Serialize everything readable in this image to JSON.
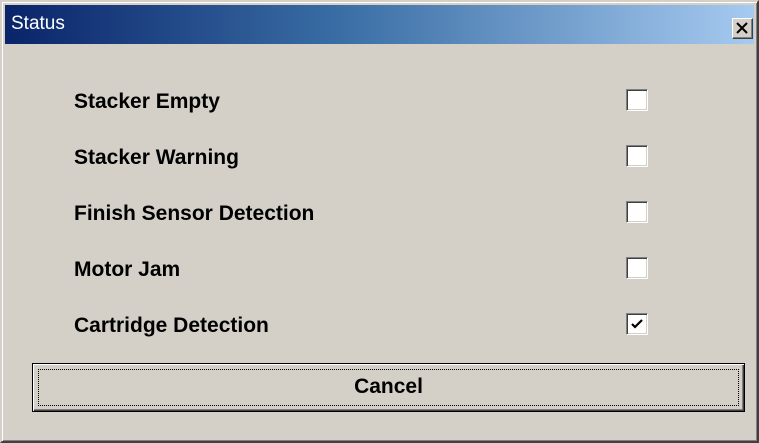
{
  "window": {
    "title": "Status"
  },
  "title_bar": {
    "close_icon": "close-icon",
    "gradient_start": "#0a246a",
    "gradient_end": "#a6caf0"
  },
  "status_items": [
    {
      "label": "Stacker Empty",
      "checked": false
    },
    {
      "label": "Stacker Warning",
      "checked": false
    },
    {
      "label": "Finish Sensor Detection",
      "checked": false
    },
    {
      "label": "Motor Jam",
      "checked": false
    },
    {
      "label": "Cartridge Detection",
      "checked": true
    }
  ],
  "buttons": {
    "cancel_label": "Cancel"
  },
  "colors": {
    "dialog_background": "#d4d0c8",
    "title_text": "#ffffff"
  }
}
